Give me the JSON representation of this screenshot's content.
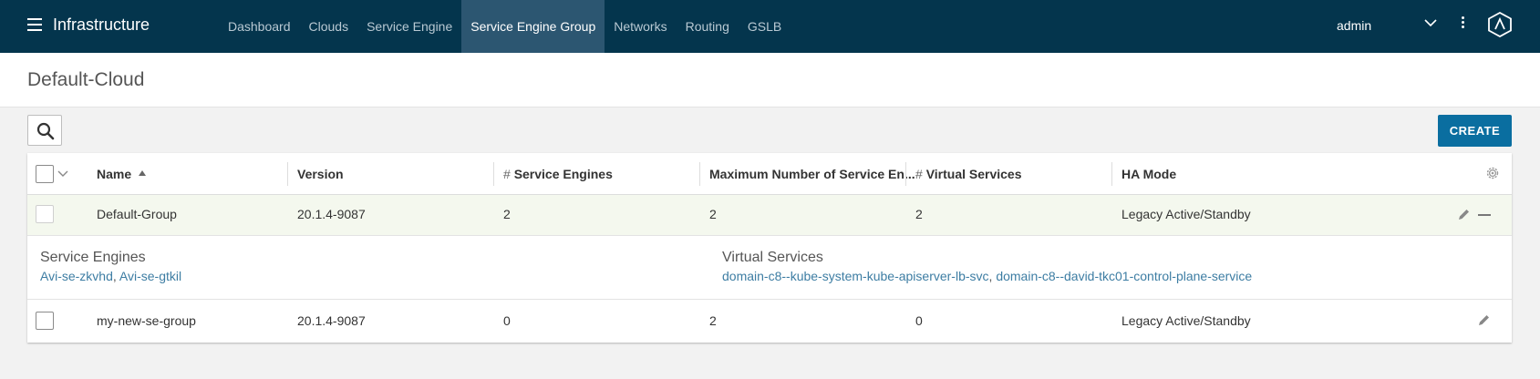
{
  "topbar": {
    "app_title": "Infrastructure",
    "nav": [
      "Dashboard",
      "Clouds",
      "Service Engine",
      "Service Engine Group",
      "Networks",
      "Routing",
      "GSLB"
    ],
    "active_nav": "Service Engine Group",
    "user": "admin"
  },
  "page": {
    "title": "Default-Cloud",
    "create_label": "CREATE"
  },
  "table": {
    "headers": {
      "name": "Name",
      "version": "Version",
      "se_hash": "#",
      "service_engines": "Service Engines",
      "max_se": "Maximum Number of Service En...",
      "vs_hash": "#",
      "virtual_services": "Virtual Services",
      "ha_mode": "HA Mode"
    },
    "rows": [
      {
        "name": "Default-Group",
        "version": "20.1.4-9087",
        "service_engines": "2",
        "max_se": "2",
        "virtual_services": "2",
        "ha_mode": "Legacy Active/Standby",
        "expanded": true
      },
      {
        "name": "my-new-se-group",
        "version": "20.1.4-9087",
        "service_engines": "0",
        "max_se": "2",
        "virtual_services": "0",
        "ha_mode": "Legacy Active/Standby",
        "expanded": false
      }
    ],
    "expanded_detail": {
      "se_title": "Service Engines",
      "se_links": [
        "Avi-se-zkvhd",
        "Avi-se-gtkil"
      ],
      "se_sep": ", ",
      "vs_title": "Virtual Services",
      "vs_links": [
        "domain-c8--kube-system-kube-apiserver-lb-svc",
        "domain-c8--david-tkc01-control-plane-service"
      ],
      "vs_sep": ", "
    }
  },
  "colors": {
    "topbar": "#04354d",
    "active_nav": "#2c5671",
    "create_button": "#0a6ea0",
    "link": "#3d7da3",
    "expanded_row": "#f4f8ee"
  }
}
